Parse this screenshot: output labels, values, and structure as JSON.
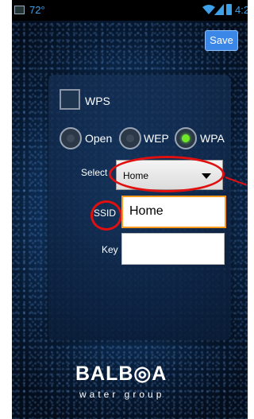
{
  "statusbar": {
    "temperature": "72°",
    "time": "4:2",
    "icons": [
      "gallery-icon",
      "wifi-icon",
      "signal-icon",
      "battery-icon"
    ]
  },
  "toolbar": {
    "save_label": "Save"
  },
  "form": {
    "wps_label": "WPS",
    "security_options": [
      {
        "label": "Open",
        "selected": false
      },
      {
        "label": "WEP",
        "selected": false
      },
      {
        "label": "WPA",
        "selected": true
      }
    ],
    "select_label": "Select",
    "select_value": "Home",
    "ssid_label": "SSID",
    "ssid_value": "Home",
    "key_label": "Key",
    "key_value": ""
  },
  "brand": {
    "name_top": "BALB◎A",
    "name_bottom": "water group"
  },
  "colors": {
    "accent": "#3b87e8",
    "highlight": "#e01010",
    "focus": "#ff9a1a",
    "radio_on": "#6fe82a"
  }
}
